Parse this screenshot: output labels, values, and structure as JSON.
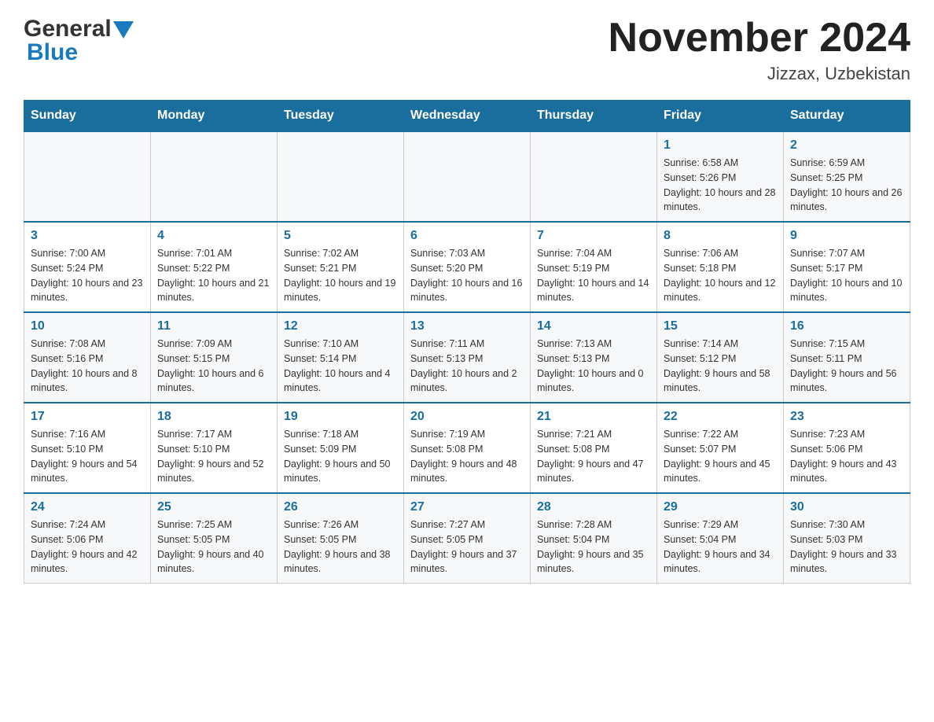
{
  "header": {
    "logo_general": "General",
    "logo_triangle": "▲",
    "logo_blue": "Blue",
    "main_title": "November 2024",
    "subtitle": "Jizzax, Uzbekistan"
  },
  "weekdays": [
    "Sunday",
    "Monday",
    "Tuesday",
    "Wednesday",
    "Thursday",
    "Friday",
    "Saturday"
  ],
  "weeks": [
    [
      {
        "day": "",
        "info": ""
      },
      {
        "day": "",
        "info": ""
      },
      {
        "day": "",
        "info": ""
      },
      {
        "day": "",
        "info": ""
      },
      {
        "day": "",
        "info": ""
      },
      {
        "day": "1",
        "info": "Sunrise: 6:58 AM\nSunset: 5:26 PM\nDaylight: 10 hours and 28 minutes."
      },
      {
        "day": "2",
        "info": "Sunrise: 6:59 AM\nSunset: 5:25 PM\nDaylight: 10 hours and 26 minutes."
      }
    ],
    [
      {
        "day": "3",
        "info": "Sunrise: 7:00 AM\nSunset: 5:24 PM\nDaylight: 10 hours and 23 minutes."
      },
      {
        "day": "4",
        "info": "Sunrise: 7:01 AM\nSunset: 5:22 PM\nDaylight: 10 hours and 21 minutes."
      },
      {
        "day": "5",
        "info": "Sunrise: 7:02 AM\nSunset: 5:21 PM\nDaylight: 10 hours and 19 minutes."
      },
      {
        "day": "6",
        "info": "Sunrise: 7:03 AM\nSunset: 5:20 PM\nDaylight: 10 hours and 16 minutes."
      },
      {
        "day": "7",
        "info": "Sunrise: 7:04 AM\nSunset: 5:19 PM\nDaylight: 10 hours and 14 minutes."
      },
      {
        "day": "8",
        "info": "Sunrise: 7:06 AM\nSunset: 5:18 PM\nDaylight: 10 hours and 12 minutes."
      },
      {
        "day": "9",
        "info": "Sunrise: 7:07 AM\nSunset: 5:17 PM\nDaylight: 10 hours and 10 minutes."
      }
    ],
    [
      {
        "day": "10",
        "info": "Sunrise: 7:08 AM\nSunset: 5:16 PM\nDaylight: 10 hours and 8 minutes."
      },
      {
        "day": "11",
        "info": "Sunrise: 7:09 AM\nSunset: 5:15 PM\nDaylight: 10 hours and 6 minutes."
      },
      {
        "day": "12",
        "info": "Sunrise: 7:10 AM\nSunset: 5:14 PM\nDaylight: 10 hours and 4 minutes."
      },
      {
        "day": "13",
        "info": "Sunrise: 7:11 AM\nSunset: 5:13 PM\nDaylight: 10 hours and 2 minutes."
      },
      {
        "day": "14",
        "info": "Sunrise: 7:13 AM\nSunset: 5:13 PM\nDaylight: 10 hours and 0 minutes."
      },
      {
        "day": "15",
        "info": "Sunrise: 7:14 AM\nSunset: 5:12 PM\nDaylight: 9 hours and 58 minutes."
      },
      {
        "day": "16",
        "info": "Sunrise: 7:15 AM\nSunset: 5:11 PM\nDaylight: 9 hours and 56 minutes."
      }
    ],
    [
      {
        "day": "17",
        "info": "Sunrise: 7:16 AM\nSunset: 5:10 PM\nDaylight: 9 hours and 54 minutes."
      },
      {
        "day": "18",
        "info": "Sunrise: 7:17 AM\nSunset: 5:10 PM\nDaylight: 9 hours and 52 minutes."
      },
      {
        "day": "19",
        "info": "Sunrise: 7:18 AM\nSunset: 5:09 PM\nDaylight: 9 hours and 50 minutes."
      },
      {
        "day": "20",
        "info": "Sunrise: 7:19 AM\nSunset: 5:08 PM\nDaylight: 9 hours and 48 minutes."
      },
      {
        "day": "21",
        "info": "Sunrise: 7:21 AM\nSunset: 5:08 PM\nDaylight: 9 hours and 47 minutes."
      },
      {
        "day": "22",
        "info": "Sunrise: 7:22 AM\nSunset: 5:07 PM\nDaylight: 9 hours and 45 minutes."
      },
      {
        "day": "23",
        "info": "Sunrise: 7:23 AM\nSunset: 5:06 PM\nDaylight: 9 hours and 43 minutes."
      }
    ],
    [
      {
        "day": "24",
        "info": "Sunrise: 7:24 AM\nSunset: 5:06 PM\nDaylight: 9 hours and 42 minutes."
      },
      {
        "day": "25",
        "info": "Sunrise: 7:25 AM\nSunset: 5:05 PM\nDaylight: 9 hours and 40 minutes."
      },
      {
        "day": "26",
        "info": "Sunrise: 7:26 AM\nSunset: 5:05 PM\nDaylight: 9 hours and 38 minutes."
      },
      {
        "day": "27",
        "info": "Sunrise: 7:27 AM\nSunset: 5:05 PM\nDaylight: 9 hours and 37 minutes."
      },
      {
        "day": "28",
        "info": "Sunrise: 7:28 AM\nSunset: 5:04 PM\nDaylight: 9 hours and 35 minutes."
      },
      {
        "day": "29",
        "info": "Sunrise: 7:29 AM\nSunset: 5:04 PM\nDaylight: 9 hours and 34 minutes."
      },
      {
        "day": "30",
        "info": "Sunrise: 7:30 AM\nSunset: 5:03 PM\nDaylight: 9 hours and 33 minutes."
      }
    ]
  ]
}
